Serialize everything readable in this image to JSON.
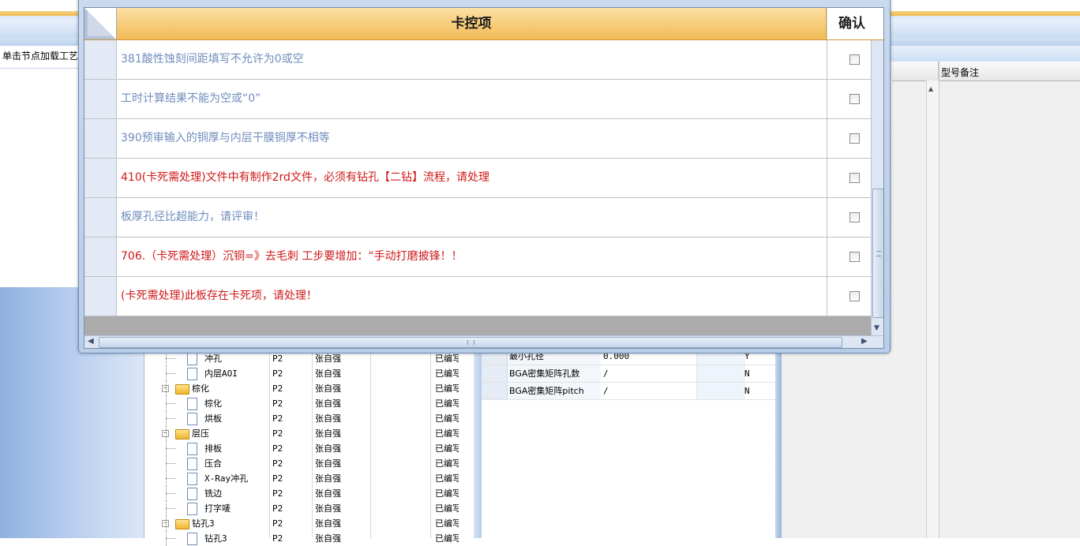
{
  "app": {
    "left_panel_label": "单击节点加载工艺",
    "right_column_header": "型号备注"
  },
  "tree": {
    "rows": [
      {
        "name": "冲孔",
        "level": "P2",
        "user": "张自强",
        "status": "已编写",
        "type": "doc"
      },
      {
        "name": "内层AOI",
        "level": "P2",
        "user": "张自强",
        "status": "已编写",
        "type": "doc"
      },
      {
        "name": "棕化",
        "level": "P2",
        "user": "张自强",
        "status": "已编写",
        "type": "folder"
      },
      {
        "name": "棕化",
        "level": "P2",
        "user": "张自强",
        "status": "已编写",
        "type": "doc"
      },
      {
        "name": "烘板",
        "level": "P2",
        "user": "张自强",
        "status": "已编写",
        "type": "doc"
      },
      {
        "name": "层压",
        "level": "P2",
        "user": "张自强",
        "status": "已编写",
        "type": "folder"
      },
      {
        "name": "排板",
        "level": "P2",
        "user": "张自强",
        "status": "已编写",
        "type": "doc"
      },
      {
        "name": "压合",
        "level": "P2",
        "user": "张自强",
        "status": "已编写",
        "type": "doc"
      },
      {
        "name": "X-Ray冲孔",
        "level": "P2",
        "user": "张自强",
        "status": "已编写",
        "type": "doc"
      },
      {
        "name": "铣边",
        "level": "P2",
        "user": "张自强",
        "status": "已编写",
        "type": "doc"
      },
      {
        "name": "打字唛",
        "level": "P2",
        "user": "张自强",
        "status": "已编写",
        "type": "doc"
      },
      {
        "name": "钻孔3",
        "level": "P2",
        "user": "张自强",
        "status": "已编写",
        "type": "folder"
      },
      {
        "name": "钻孔3",
        "level": "P2",
        "user": "张自强",
        "status": "已编写",
        "type": "doc"
      }
    ]
  },
  "params": {
    "rows": [
      {
        "name": "最小孔径",
        "value": "0.000",
        "flag": "Y"
      },
      {
        "name": "BGA密集矩阵孔数",
        "value": "/",
        "flag": "N"
      },
      {
        "name": "BGA密集矩阵pitch",
        "value": "/",
        "flag": "N"
      }
    ]
  },
  "dialog": {
    "header_title": "卡控项",
    "header_confirm": "确认",
    "rows": [
      {
        "text": "381酸性蚀刻间距填写不允许为0或空",
        "alert": false,
        "checked": false
      },
      {
        "text": "工时计算结果不能为空或“0”",
        "alert": false,
        "checked": false
      },
      {
        "text": "390预审输入的铜厚与内层干膜铜厚不相等",
        "alert": false,
        "checked": false
      },
      {
        "text": "410(卡死需处理)文件中有制作2rd文件，必须有钻孔【二钻】流程，请处理",
        "alert": true,
        "checked": false
      },
      {
        "text": "板厚孔径比超能力，请评审！",
        "alert": false,
        "checked": false
      },
      {
        "text": "706.（卡死需处理）沉铜=》去毛刺 工步要增加：“手动打磨披锋！！",
        "alert": true,
        "checked": false
      },
      {
        "text": "(卡死需处理)此板存在卡死项，请处理！",
        "alert": true,
        "checked": false
      }
    ]
  },
  "colors": {
    "normal_text": "#6e8cbd",
    "alert_text": "#d01818",
    "header_gradient_top": "#fbe0a4",
    "header_gradient_bottom": "#f3bb55"
  },
  "icons": {
    "scroll_up": "▲",
    "scroll_down": "▼",
    "scroll_left": "◀",
    "scroll_right": "▶"
  }
}
